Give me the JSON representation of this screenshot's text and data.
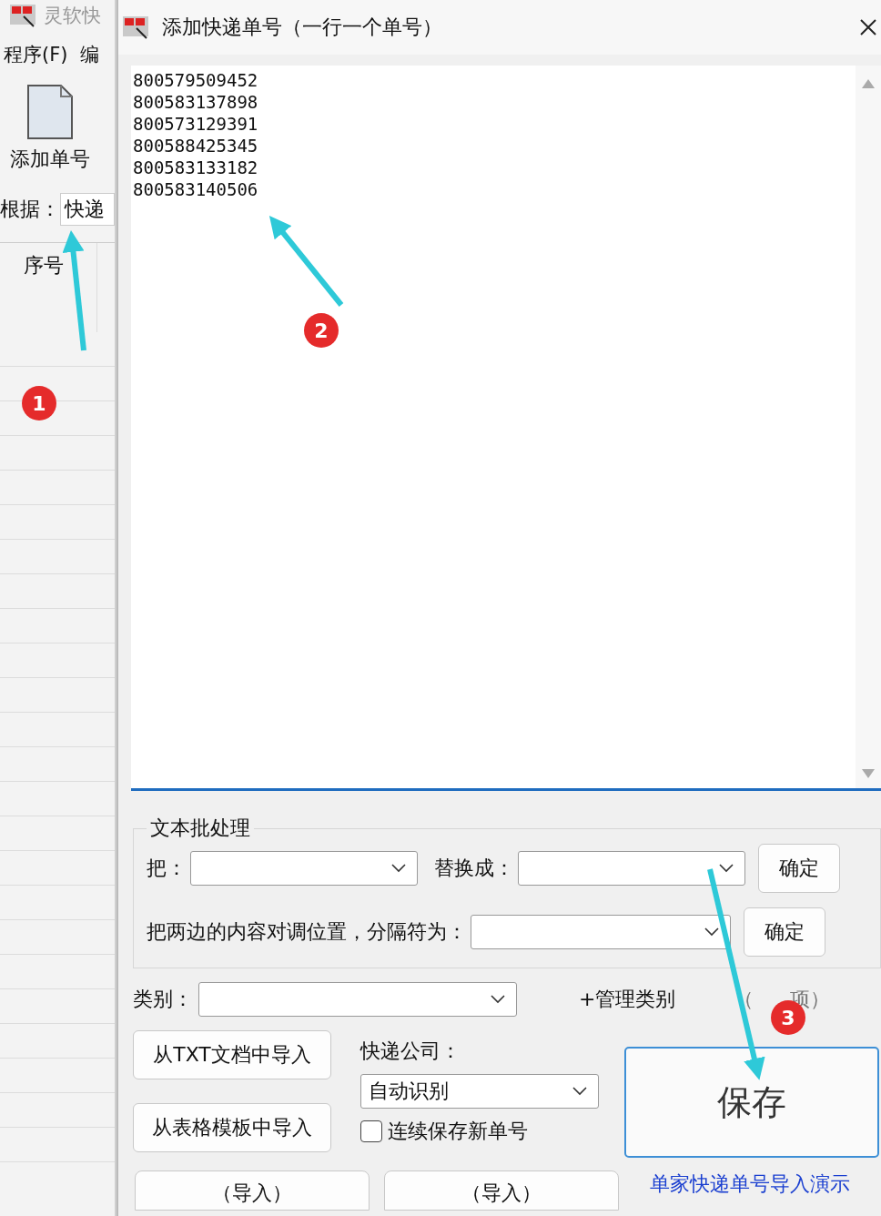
{
  "background_window": {
    "title": "灵软快",
    "menu": [
      "程序(F)",
      "编"
    ],
    "toolbar_button": "添加单号",
    "filter_label": "根据：",
    "filter_value": "快递",
    "table_header": "序号"
  },
  "dialog": {
    "title": "添加快递单号（一行一个单号）",
    "numbers": [
      "800579509452",
      "800583137898",
      "800573129391",
      "800588425345",
      "800583133182",
      "800583140506"
    ],
    "batch": {
      "title": "文本批处理",
      "find_label": "把：",
      "replace_label": "替换成：",
      "confirm": "确定",
      "swap_label": "把两边的内容对调位置，分隔符为：",
      "swap_confirm": "确定"
    },
    "category": {
      "label": "类别：",
      "manage": "+管理类别",
      "optional_start": "（",
      "optional_end": "项）"
    },
    "import_txt": "从TXT文档中导入",
    "import_table": "从表格模板中导入",
    "courier": {
      "label": "快递公司：",
      "value": "自动识别"
    },
    "continuous": {
      "label": "连续保存新单号",
      "checked": false
    },
    "save": "保存",
    "demo_link": "单家快递单号导入演示",
    "import_buttons": [
      "（导入）",
      "（导入）"
    ]
  },
  "annotations": [
    {
      "number": "1"
    },
    {
      "number": "2"
    },
    {
      "number": "3"
    }
  ]
}
